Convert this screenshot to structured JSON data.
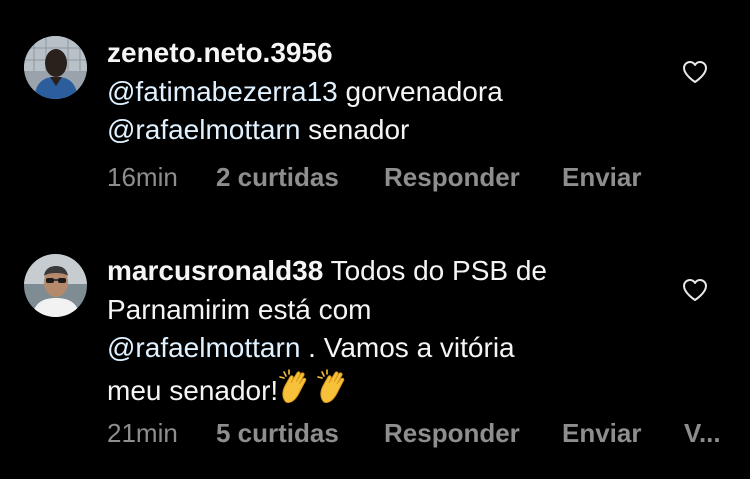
{
  "comments": [
    {
      "username": "zeneto.neto.3956",
      "mention1": "@fatimabezerra13",
      "text1": " gorvenadora",
      "mention2": "@rafaelmottarn",
      "text2": " senador",
      "time": "16min",
      "likes": "2 curtidas",
      "reply": "Responder",
      "send": "Enviar",
      "like_icon": "heart-outline-icon"
    },
    {
      "username": "marcusronald38",
      "text1": " Todos do PSB de",
      "text2": "Parnamirim está com",
      "mention1": "@rafaelmottarn",
      "text3": " . Vamos a vitória",
      "text4": "meu senador!",
      "emoji": "clapping-hands-emoji",
      "time": "21min",
      "likes": "5 curtidas",
      "reply": "Responder",
      "send": "Enviar",
      "more": "V...",
      "like_icon": "heart-outline-icon"
    }
  ],
  "colors": {
    "background": "#000000",
    "text": "#f5f5f5",
    "mention": "#e0f1ff",
    "meta": "#8e8e8e"
  }
}
